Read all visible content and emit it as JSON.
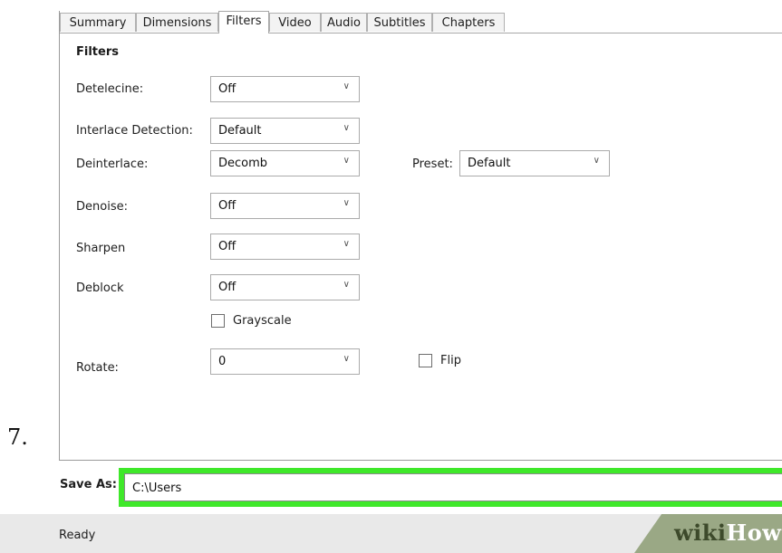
{
  "step_number": "7.",
  "tabs": [
    "Summary",
    "Dimensions",
    "Filters",
    "Video",
    "Audio",
    "Subtitles",
    "Chapters"
  ],
  "active_tab": "Filters",
  "filters": {
    "heading": "Filters",
    "detelecine": {
      "label": "Detelecine:",
      "value": "Off"
    },
    "interlace_detection": {
      "label": "Interlace Detection:",
      "value": "Default"
    },
    "deinterlace": {
      "label": "Deinterlace:",
      "value": "Decomb"
    },
    "preset": {
      "label": "Preset:",
      "value": "Default"
    },
    "denoise": {
      "label": "Denoise:",
      "value": "Off"
    },
    "sharpen": {
      "label": "Sharpen",
      "value": "Off"
    },
    "deblock": {
      "label": "Deblock",
      "value": "Off"
    },
    "grayscale": {
      "label": "Grayscale",
      "checked": false
    },
    "rotate": {
      "label": "Rotate:",
      "value": "0"
    },
    "flip": {
      "label": "Flip",
      "checked": false
    }
  },
  "save_as": {
    "label": "Save As:",
    "value": "C:\\Users"
  },
  "status": "Ready",
  "watermark": {
    "part1": "wiki",
    "part2": "How"
  },
  "colors": {
    "highlight": "#3fe82a",
    "watermark_band": "#9aa885"
  }
}
